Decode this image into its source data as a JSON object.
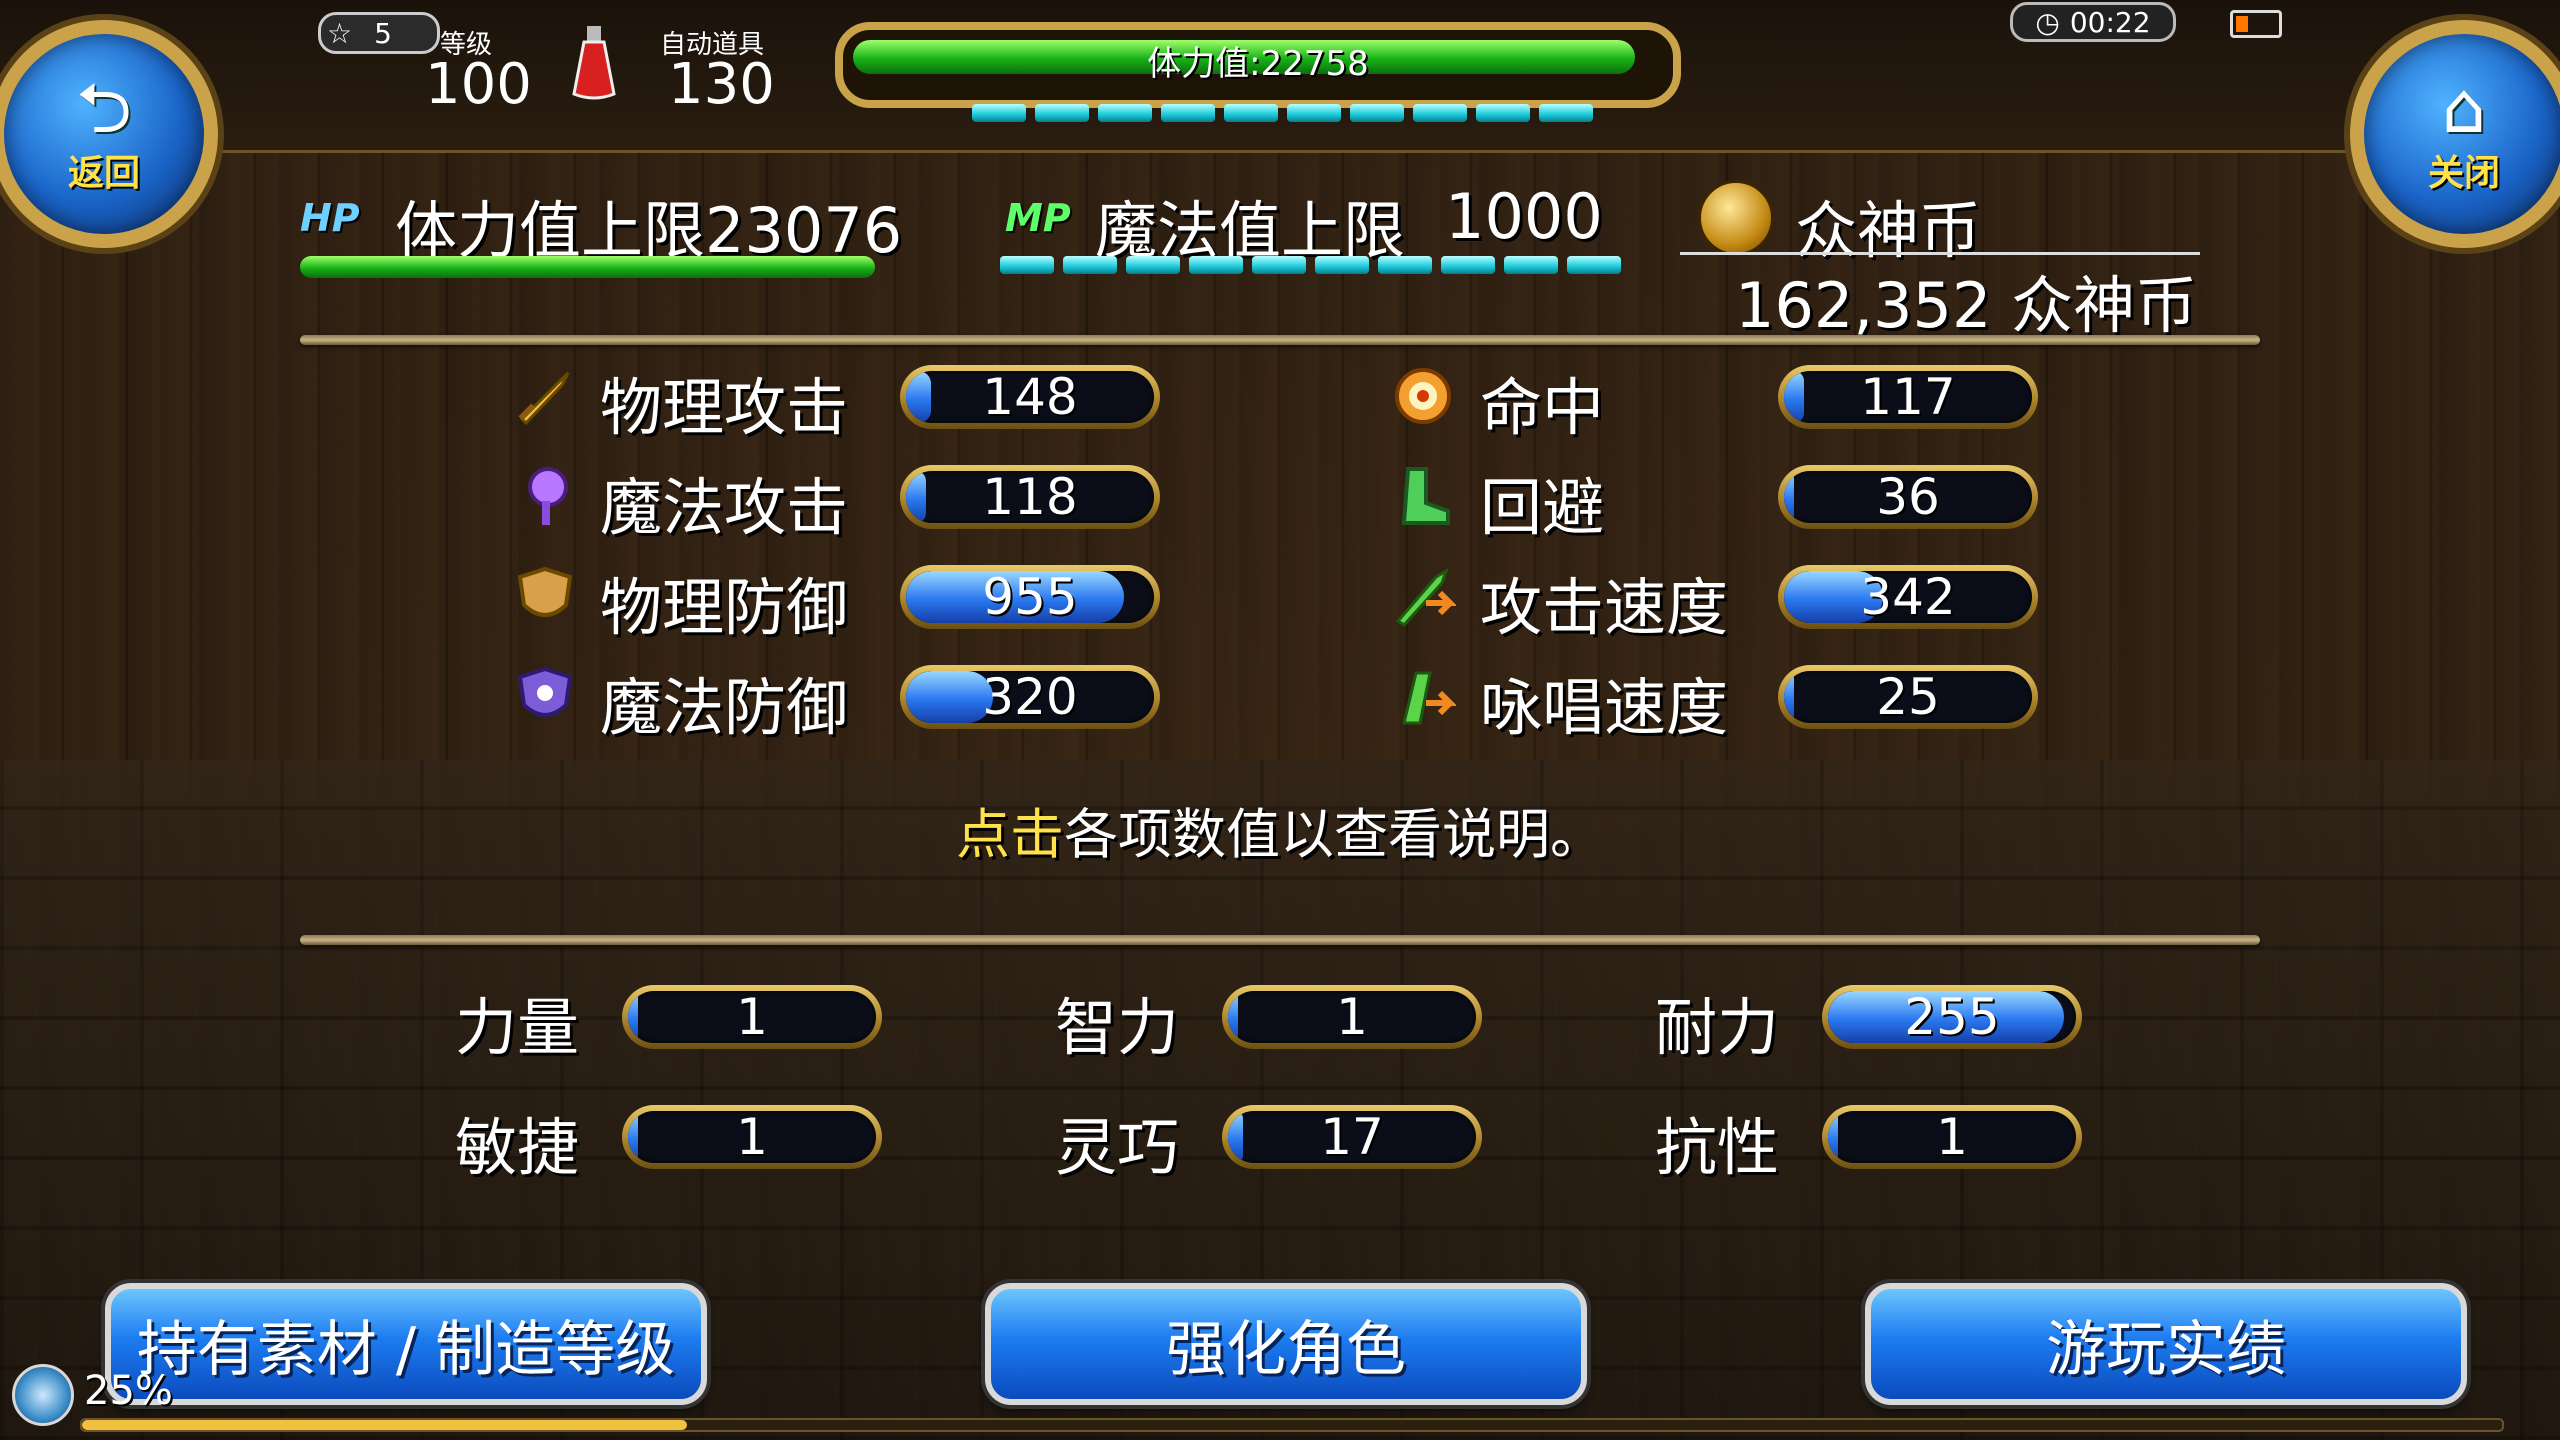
{
  "header": {
    "back_label": "返回",
    "close_label": "关闭",
    "star_rank": "5",
    "level_label": "等级",
    "level_value": "100",
    "auto_item_label": "自动道具",
    "auto_item_value": "130",
    "hp_text": "体力值:22758",
    "hp_fraction": 0.99,
    "mp_segments": 10,
    "clock": "00:22"
  },
  "max_stats": {
    "hp_badge": "HP",
    "hp_label": "体力值上限23076",
    "mp_badge": "MP",
    "mp_label": "魔法值上限",
    "mp_value": "1000",
    "currency_label": "众神币",
    "currency_value": "162,352 众神币"
  },
  "combat_stats": [
    {
      "label": "物理攻击",
      "value": "148",
      "fill": 0.1,
      "icon": "sword-icon"
    },
    {
      "label": "魔法攻击",
      "value": "118",
      "fill": 0.08,
      "icon": "magic-staff-icon"
    },
    {
      "label": "物理防御",
      "value": "955",
      "fill": 0.88,
      "icon": "shield-icon"
    },
    {
      "label": "魔法防御",
      "value": "320",
      "fill": 0.35,
      "icon": "magic-shield-icon"
    },
    {
      "label": "命中",
      "value": "117",
      "fill": 0.08,
      "icon": "target-icon"
    },
    {
      "label": "回避",
      "value": "36",
      "fill": 0.04,
      "icon": "boot-icon"
    },
    {
      "label": "攻击速度",
      "value": "342",
      "fill": 0.4,
      "icon": "attack-speed-icon"
    },
    {
      "label": "咏唱速度",
      "value": "25",
      "fill": 0.03,
      "icon": "cast-speed-icon"
    }
  ],
  "hint": {
    "highlight": "点击",
    "rest": "各项数值以查看说明。"
  },
  "base_stats": [
    {
      "label": "力量",
      "value": "1",
      "fill": 0.02
    },
    {
      "label": "智力",
      "value": "1",
      "fill": 0.02
    },
    {
      "label": "耐力",
      "value": "255",
      "fill": 0.95
    },
    {
      "label": "敏捷",
      "value": "1",
      "fill": 0.02
    },
    {
      "label": "灵巧",
      "value": "17",
      "fill": 0.06
    },
    {
      "label": "抗性",
      "value": "1",
      "fill": 0.02
    }
  ],
  "buttons": {
    "materials": "持有素材 / 制造等级",
    "enhance": "强化角色",
    "achievements": "游玩实绩"
  },
  "progress": {
    "text": "25%",
    "fraction": 0.25
  },
  "colors": {
    "gold_frame": "#c9a24a",
    "hp_green": "#18b318",
    "mp_cyan": "#18c8d8",
    "stat_blue": "#2a78f0",
    "button_blue": "#1d7cf0",
    "hint_yellow": "#ffe24a"
  }
}
